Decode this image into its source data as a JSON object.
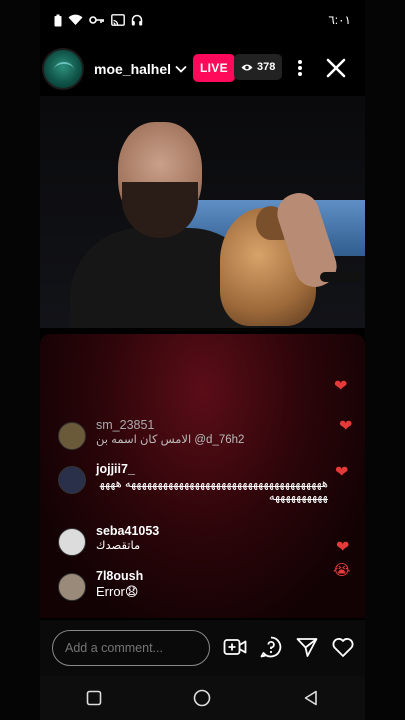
{
  "status_bar": {
    "time": "٦:٠١"
  },
  "header": {
    "username": "moe_halhel",
    "live_label": "LIVE",
    "viewer_count": "378"
  },
  "comments": [
    {
      "username": "sm_23851",
      "text": "الامس كان اسمه بن @d_76h2",
      "avatar_color": "#6b5a3a"
    },
    {
      "username": "jojjii7_",
      "text": "هههههههههههههههههههههههههههههههههههههه ههههههههههههههه",
      "avatar_color": "#2a2f4a"
    },
    {
      "username": "seba41053",
      "text": "ماتقصدك",
      "avatar_color": "#dcdcdc"
    },
    {
      "username": "7l8oush",
      "text": "Error😧",
      "avatar_color": "#9a8a7a"
    }
  ],
  "floating_reactions": [
    "heart",
    "heart",
    "heart",
    "heart",
    "crying-face"
  ],
  "comment_input": {
    "placeholder": "Add a comment..."
  },
  "colors": {
    "live": "#ff0a5a",
    "heart": "#e53a3a"
  }
}
